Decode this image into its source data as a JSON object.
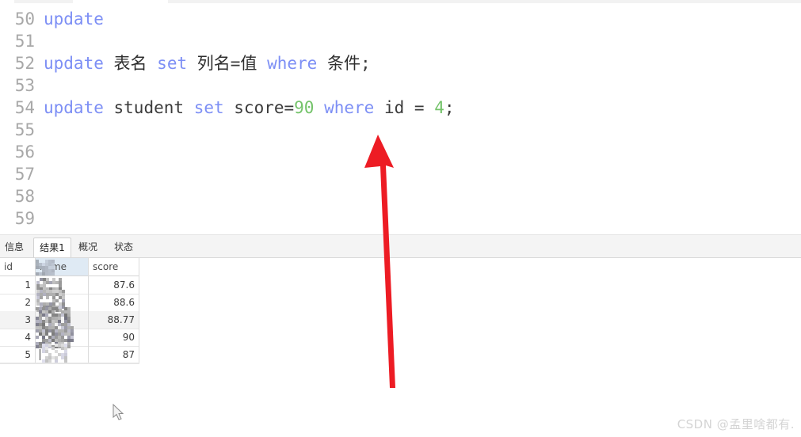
{
  "editor": {
    "lines": [
      {
        "number": "50",
        "tokens": [
          {
            "t": "update",
            "k": "kw"
          }
        ]
      },
      {
        "number": "51",
        "tokens": []
      },
      {
        "number": "52",
        "tokens": [
          {
            "t": "update",
            "k": "kw"
          },
          {
            "t": " ",
            "k": "op"
          },
          {
            "t": "表名",
            "k": "cn"
          },
          {
            "t": " ",
            "k": "op"
          },
          {
            "t": "set",
            "k": "kw"
          },
          {
            "t": " ",
            "k": "op"
          },
          {
            "t": "列名",
            "k": "cn"
          },
          {
            "t": "=",
            "k": "op"
          },
          {
            "t": "值",
            "k": "cn"
          },
          {
            "t": " ",
            "k": "op"
          },
          {
            "t": "where",
            "k": "kw"
          },
          {
            "t": " ",
            "k": "op"
          },
          {
            "t": "条件",
            "k": "cn"
          },
          {
            "t": ";",
            "k": "op"
          }
        ]
      },
      {
        "number": "53",
        "tokens": []
      },
      {
        "number": "54",
        "tokens": [
          {
            "t": "update",
            "k": "kw"
          },
          {
            "t": " ",
            "k": "op"
          },
          {
            "t": "student",
            "k": "id"
          },
          {
            "t": " ",
            "k": "op"
          },
          {
            "t": "set",
            "k": "kw"
          },
          {
            "t": " ",
            "k": "op"
          },
          {
            "t": "score",
            "k": "id"
          },
          {
            "t": "=",
            "k": "op"
          },
          {
            "t": "90",
            "k": "num"
          },
          {
            "t": " ",
            "k": "op"
          },
          {
            "t": "where",
            "k": "kw"
          },
          {
            "t": " ",
            "k": "op"
          },
          {
            "t": "id",
            "k": "id"
          },
          {
            "t": " = ",
            "k": "op"
          },
          {
            "t": "4",
            "k": "num"
          },
          {
            "t": ";",
            "k": "op"
          }
        ]
      },
      {
        "number": "55",
        "tokens": []
      },
      {
        "number": "56",
        "tokens": []
      },
      {
        "number": "57",
        "tokens": []
      },
      {
        "number": "58",
        "tokens": []
      },
      {
        "number": "59",
        "tokens": []
      }
    ]
  },
  "results": {
    "tabs": [
      {
        "label": "信息",
        "active": false
      },
      {
        "label": "结果1",
        "active": true
      },
      {
        "label": "概况",
        "active": false
      },
      {
        "label": "状态",
        "active": false
      }
    ],
    "columns": [
      "id",
      "name",
      "score"
    ],
    "selected_column": "name",
    "rows": [
      {
        "id": "1",
        "name": "",
        "score": "87.6"
      },
      {
        "id": "2",
        "name": "",
        "score": "88.6"
      },
      {
        "id": "3",
        "name": "",
        "score": "88.77"
      },
      {
        "id": "4",
        "name": "",
        "score": "90"
      },
      {
        "id": "5",
        "name": "",
        "score": "87"
      }
    ],
    "name_column_redacted": true,
    "editing_row_index": 4
  },
  "annotation": {
    "arrow_color": "#ed1c24",
    "arrow_points_to": "90"
  },
  "watermark": {
    "text": "CSDN @孟里啥都有."
  },
  "colors": {
    "keyword": "#7d8ff5",
    "identifier": "#3b3b3b",
    "number": "#74c36a",
    "gutter": "#a8a8a8",
    "header_selected": "#dfeaf4",
    "row_alt": "#f3f3f3",
    "arrow": "#ed1c24",
    "watermark": "#d4d4d4"
  }
}
